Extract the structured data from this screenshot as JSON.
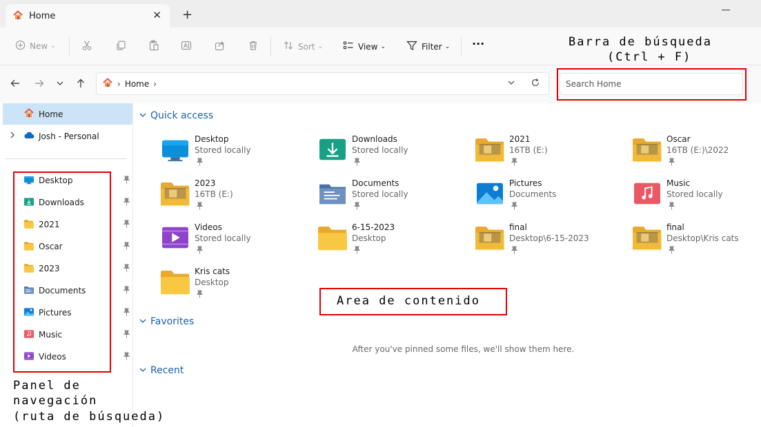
{
  "tab": {
    "title": "Home",
    "close": "✕",
    "new_tab": "+"
  },
  "toolbar": {
    "new_label": "New",
    "sort_label": "Sort",
    "view_label": "View",
    "filter_label": "Filter",
    "more_label": "···"
  },
  "address": {
    "breadcrumb": "Home",
    "crumb_sep": "›",
    "search_placeholder": "Search Home"
  },
  "sidebar": {
    "top": [
      {
        "label": "Home"
      },
      {
        "label": "Josh - Personal"
      }
    ],
    "pinned": [
      {
        "label": "Desktop",
        "icon": "desktop-icon"
      },
      {
        "label": "Downloads",
        "icon": "downloads-icon"
      },
      {
        "label": "2021",
        "icon": "folder-icon"
      },
      {
        "label": "Oscar",
        "icon": "folder-icon"
      },
      {
        "label": "2023",
        "icon": "folder-icon"
      },
      {
        "label": "Documents",
        "icon": "documents-icon"
      },
      {
        "label": "Pictures",
        "icon": "pictures-icon"
      },
      {
        "label": "Music",
        "icon": "music-icon"
      },
      {
        "label": "Videos",
        "icon": "videos-icon"
      }
    ]
  },
  "sections": {
    "quick_access": "Quick access",
    "favorites": "Favorites",
    "recent": "Recent",
    "favorites_empty": "After you've pinned some files, we'll show them here."
  },
  "quick_access": [
    {
      "name": "Desktop",
      "sub": "Stored locally"
    },
    {
      "name": "Downloads",
      "sub": "Stored locally"
    },
    {
      "name": "2021",
      "sub": "16TB (E:)"
    },
    {
      "name": "Oscar",
      "sub": "16TB (E:)\\2022"
    },
    {
      "name": "2023",
      "sub": "16TB (E:)"
    },
    {
      "name": "Documents",
      "sub": "Stored locally"
    },
    {
      "name": "Pictures",
      "sub": "Documents"
    },
    {
      "name": "Music",
      "sub": "Stored locally"
    },
    {
      "name": "Videos",
      "sub": "Stored locally"
    },
    {
      "name": "6-15-2023",
      "sub": "Desktop"
    },
    {
      "name": "final",
      "sub": "Desktop\\6-15-2023"
    },
    {
      "name": "final",
      "sub": "Desktop\\Kris cats"
    },
    {
      "name": "Kris cats",
      "sub": "Desktop"
    }
  ],
  "annotations": {
    "search_bar_line1": "Barra de búsqueda",
    "search_bar_line2": "(Ctrl + F)",
    "content_area": "Area de contenido",
    "nav_line1": "Panel de",
    "nav_line2": "navegación",
    "nav_line3": "(ruta de búsqueda)"
  },
  "colors": {
    "accent": "#1a5fb4",
    "selected": "#cce4f7",
    "annotation_red": "#e00000",
    "folder_yellow": "#f8c843"
  }
}
